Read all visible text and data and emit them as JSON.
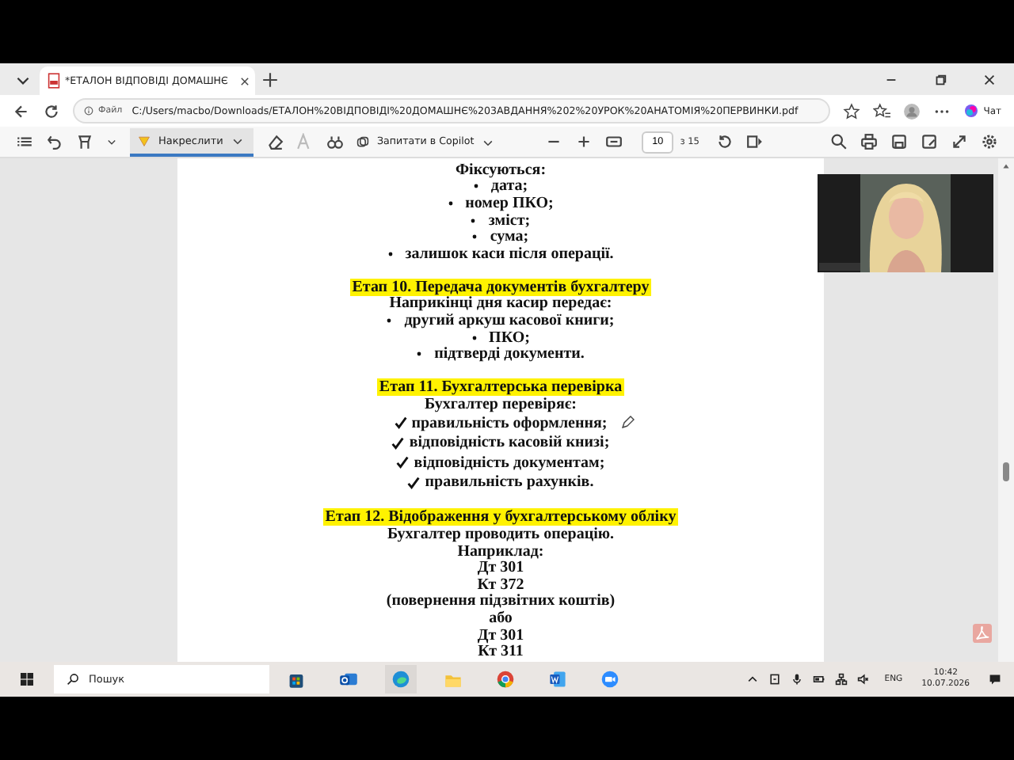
{
  "tab": {
    "title": "*ЕТАЛОН ВІДПОВІДІ ДОМАШНЄ"
  },
  "address": {
    "scheme": "Файл",
    "url": "C:/Users/macbo/Downloads/ЕТАЛОН%20ВІДПОВІДІ%20ДОМАШНЄ%203АВДАННЯ%202%20УРОК%20АНАТОМІЯ%20ПЕРВИНКИ.pdf",
    "chat": "Чат"
  },
  "toolbar": {
    "draw": {
      "label": "Накреслити",
      "selected": true
    },
    "copilot": "Запитати в Copilot",
    "page": "10",
    "of": "з 15"
  },
  "document": [
    {
      "kind": "line",
      "text": "Фіксуються:"
    },
    {
      "kind": "bullet",
      "text": "дата;"
    },
    {
      "kind": "bullet",
      "text": "номер ПКО;"
    },
    {
      "kind": "bullet",
      "text": "зміст;"
    },
    {
      "kind": "bullet",
      "text": "сума;"
    },
    {
      "kind": "bullet",
      "text": "залишок каси після операції."
    },
    {
      "kind": "heading",
      "text": "Етап 10. Передача документів бухгалтеру"
    },
    {
      "kind": "line",
      "text": "Наприкінці дня касир передає:"
    },
    {
      "kind": "bullet",
      "text": "другий аркуш касової книги;"
    },
    {
      "kind": "bullet",
      "text": "ПКО;"
    },
    {
      "kind": "bullet",
      "text": "підтверді документи."
    },
    {
      "kind": "heading",
      "text": "Етап 11. Бухгалтерська перевірка"
    },
    {
      "kind": "line",
      "text": "Бухгалтер перевіряє:"
    },
    {
      "kind": "check",
      "text": "правильність оформлення;"
    },
    {
      "kind": "check",
      "text": "відповідність касовій книзі;"
    },
    {
      "kind": "check",
      "text": "відповідність документам;"
    },
    {
      "kind": "check",
      "text": "правильність рахунків."
    },
    {
      "kind": "heading",
      "text": "Етап 12. Відображення у бухгалтерському обліку"
    },
    {
      "kind": "line",
      "text": "Бухгалтер проводить операцію."
    },
    {
      "kind": "line",
      "text": "Наприклад:"
    },
    {
      "kind": "line",
      "text": "Дт 301"
    },
    {
      "kind": "line",
      "text": "Кт 372"
    },
    {
      "kind": "line",
      "text": "(повернення підзвітних коштів)"
    },
    {
      "kind": "line",
      "text": "або"
    },
    {
      "kind": "line",
      "text": "Дт 301"
    },
    {
      "kind": "line",
      "text": "Кт 311"
    }
  ],
  "taskbar": {
    "search": "Пошук",
    "lang": "ENG",
    "time": "10:42",
    "date": "10.07.2026"
  }
}
